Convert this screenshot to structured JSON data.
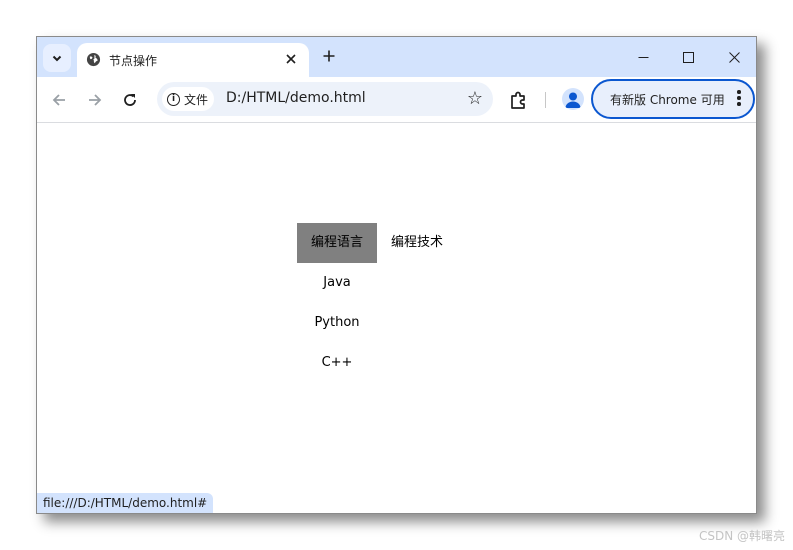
{
  "browser": {
    "tab_title": "节点操作",
    "url": "D:/HTML/demo.html",
    "site_chip_label": "文件",
    "update_label": "有新版 Chrome 可用",
    "status_url": "file:///D:/HTML/demo.html#",
    "accent_color": "#0b57d0",
    "tabstrip_color": "#d3e3fd"
  },
  "icons": {
    "tab_search": "chevron-down-icon",
    "favicon": "globe-icon",
    "tab_close": "close-icon",
    "new_tab": "plus-icon",
    "back": "arrow-left-icon",
    "forward": "arrow-right-icon",
    "reload": "reload-icon",
    "info": "info-icon",
    "bookmark": "star-icon",
    "extensions": "puzzle-icon",
    "profile": "person-icon",
    "menu": "kebab-icon"
  },
  "page": {
    "menu": [
      {
        "label": "编程语言",
        "active": true,
        "highlight_color": "#808080",
        "items": [
          "Java",
          "Python",
          "C++"
        ]
      },
      {
        "label": "编程技术",
        "active": false,
        "items": []
      }
    ]
  },
  "watermark": "CSDN @韩曙亮"
}
